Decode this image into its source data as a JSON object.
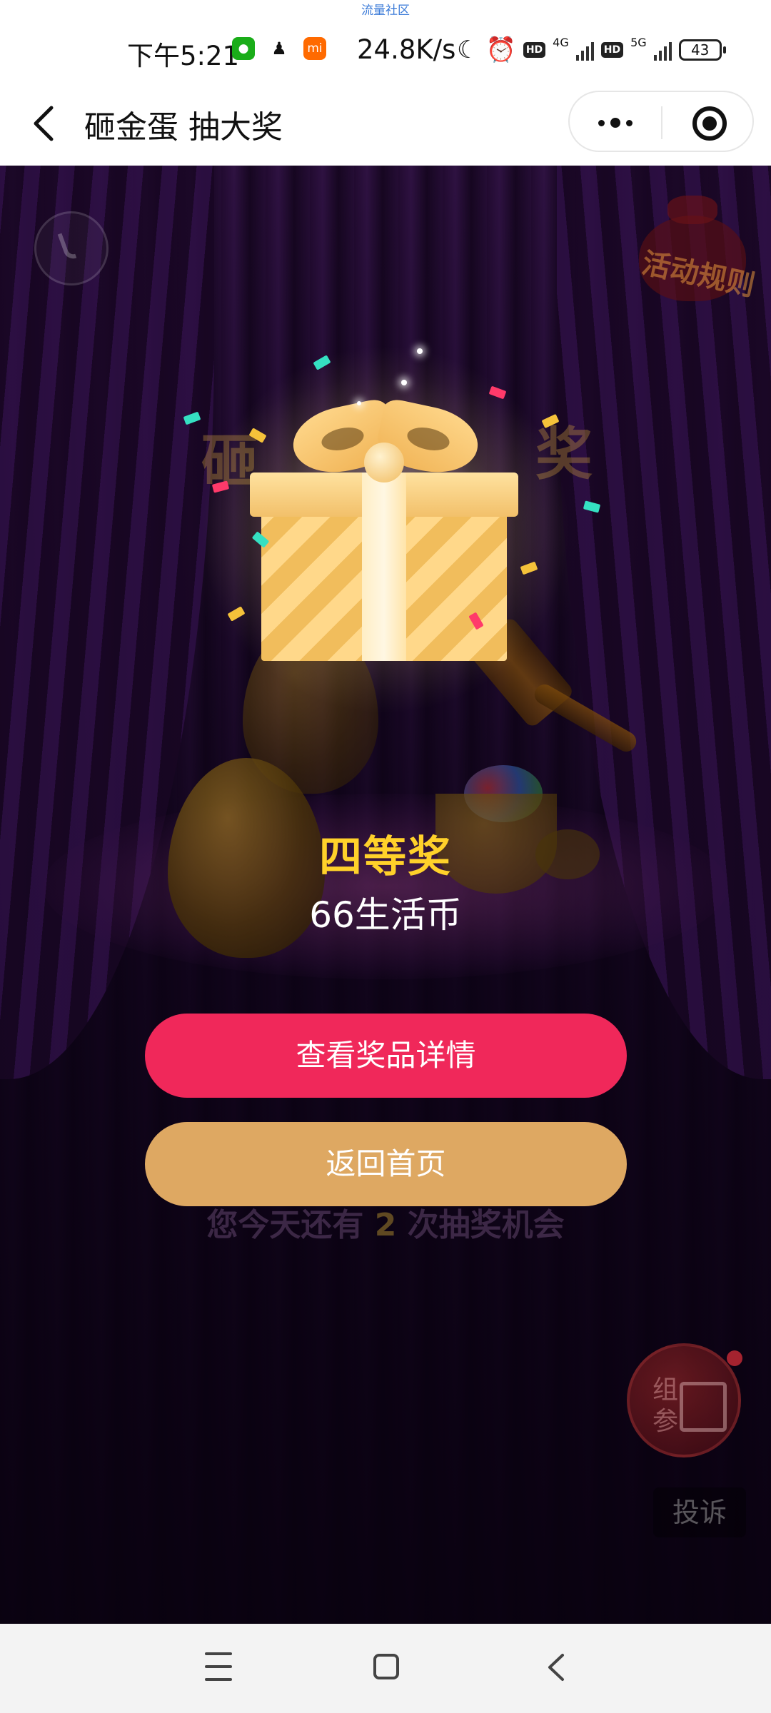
{
  "status_bar": {
    "top_tag": "流量社区",
    "time": "下午5:21",
    "speed": "24.8K/s",
    "network_1": "4G",
    "network_2": "5G",
    "hd": "HD",
    "battery": "43",
    "app_icons": [
      "wechat-icon",
      "qq-icon",
      "mi-icon"
    ]
  },
  "title_bar": {
    "title": "砸金蛋 抽大奖"
  },
  "scene": {
    "rules_badge": "活动规则",
    "bg_left_char": "砸",
    "bg_right_char": "奖"
  },
  "prize": {
    "level": "四等奖",
    "amount": "66生活币"
  },
  "buttons": {
    "detail": "查看奖品详情",
    "home": "返回首页"
  },
  "chances": {
    "prefix": "您今天还有 ",
    "count": "2",
    "suffix": " 次抽奖机会"
  },
  "float_gift": {
    "label": "组\n参"
  },
  "report": {
    "label": "投诉"
  },
  "colors": {
    "detail_button": "#f0285a",
    "home_button": "#dea862",
    "prize_level": "#ffd12a",
    "background": "#14061c"
  }
}
